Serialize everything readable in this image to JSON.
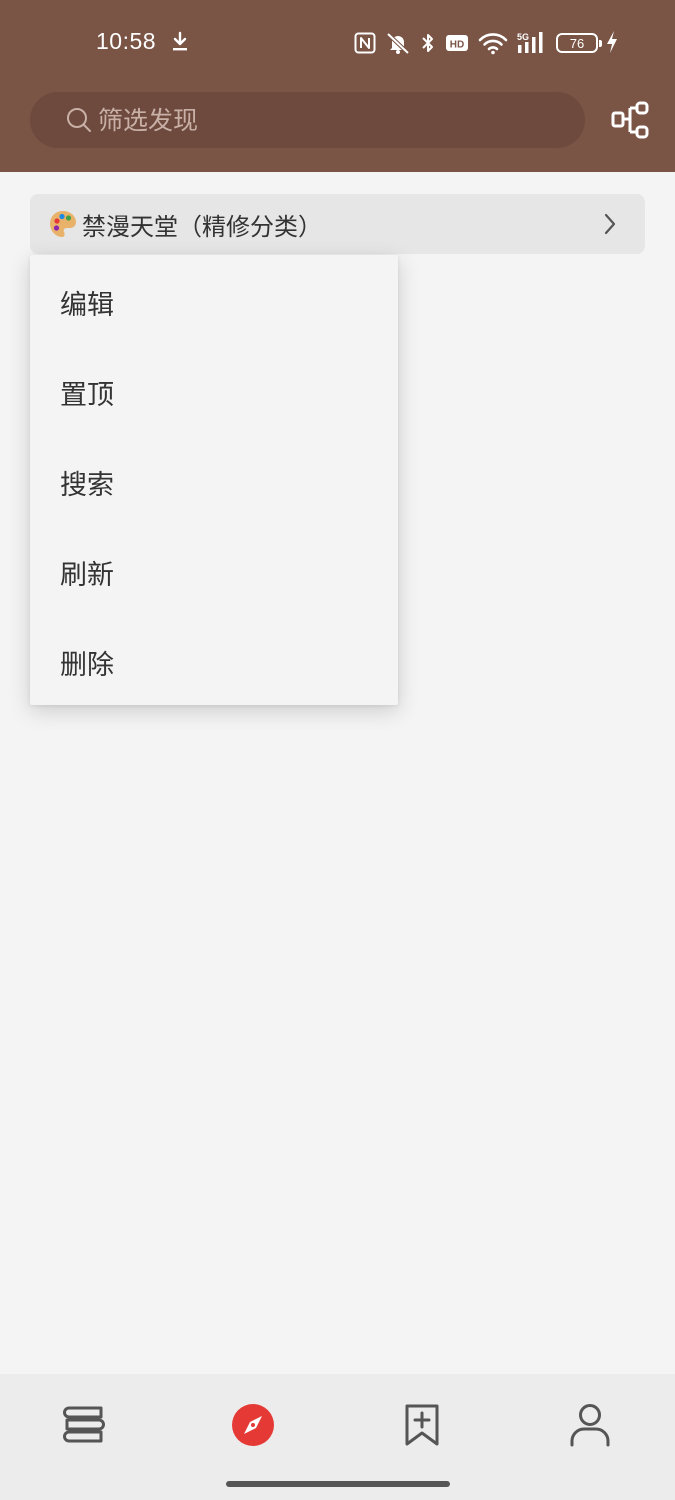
{
  "status_bar": {
    "time": "10:58",
    "network_label": "5G",
    "hd_label": "HD",
    "battery_level": "76"
  },
  "header": {
    "search_placeholder": "筛选发现",
    "bg_color": "#7a5445"
  },
  "source": {
    "label": "禁漫天堂（精修分类）"
  },
  "context_menu": {
    "items": [
      {
        "label": "编辑"
      },
      {
        "label": "置顶"
      },
      {
        "label": "搜索"
      },
      {
        "label": "刷新"
      },
      {
        "label": "删除"
      }
    ]
  },
  "bottom_nav": {
    "items": [
      {
        "icon": "bookshelf-icon",
        "active": false
      },
      {
        "icon": "compass-icon",
        "active": true
      },
      {
        "icon": "rss-bookmark-icon",
        "active": false
      },
      {
        "icon": "person-icon",
        "active": false
      }
    ],
    "active_color": "#e53935"
  }
}
